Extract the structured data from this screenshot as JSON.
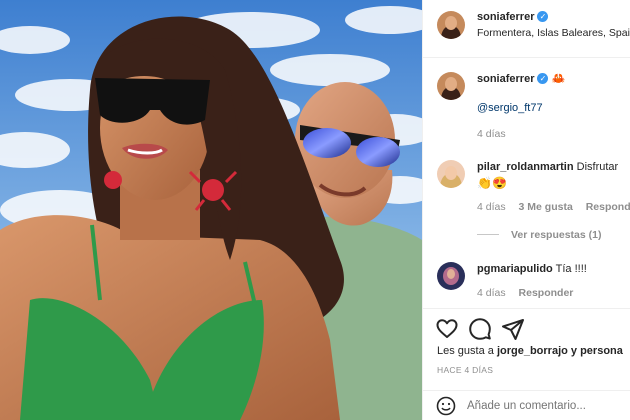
{
  "post": {
    "owner": "soniaferrer",
    "location": "Formentera, Islas Baleares, Spain"
  },
  "caption": {
    "username": "soniaferrer",
    "emoji": "🦀",
    "mention": "@sergio_ft77",
    "time": "4 días"
  },
  "comments": [
    {
      "username": "pilar_roldanmartin",
      "text": "Disfrutar",
      "emoji": "👏😍",
      "time": "4 días",
      "likes": "3 Me gusta",
      "reply": "Responder",
      "view_replies": "Ver respuestas (1)"
    },
    {
      "username": "pgmariapulido",
      "text": "Tía !!!!",
      "time": "4 días",
      "reply": "Responder"
    }
  ],
  "likes_line": {
    "prefix": "Les gusta a",
    "user": "jorge_borrajo",
    "suffix": "y persona"
  },
  "post_time": "HACE 4 DÍAS",
  "add_comment_placeholder": "Añade un comentario...",
  "icons": [
    "heart-icon",
    "comment-icon",
    "share-icon",
    "emoji-icon",
    "verified-icon"
  ],
  "colors": {
    "verified": "#3897f0",
    "meta": "#8e8e8e",
    "text": "#262626"
  }
}
